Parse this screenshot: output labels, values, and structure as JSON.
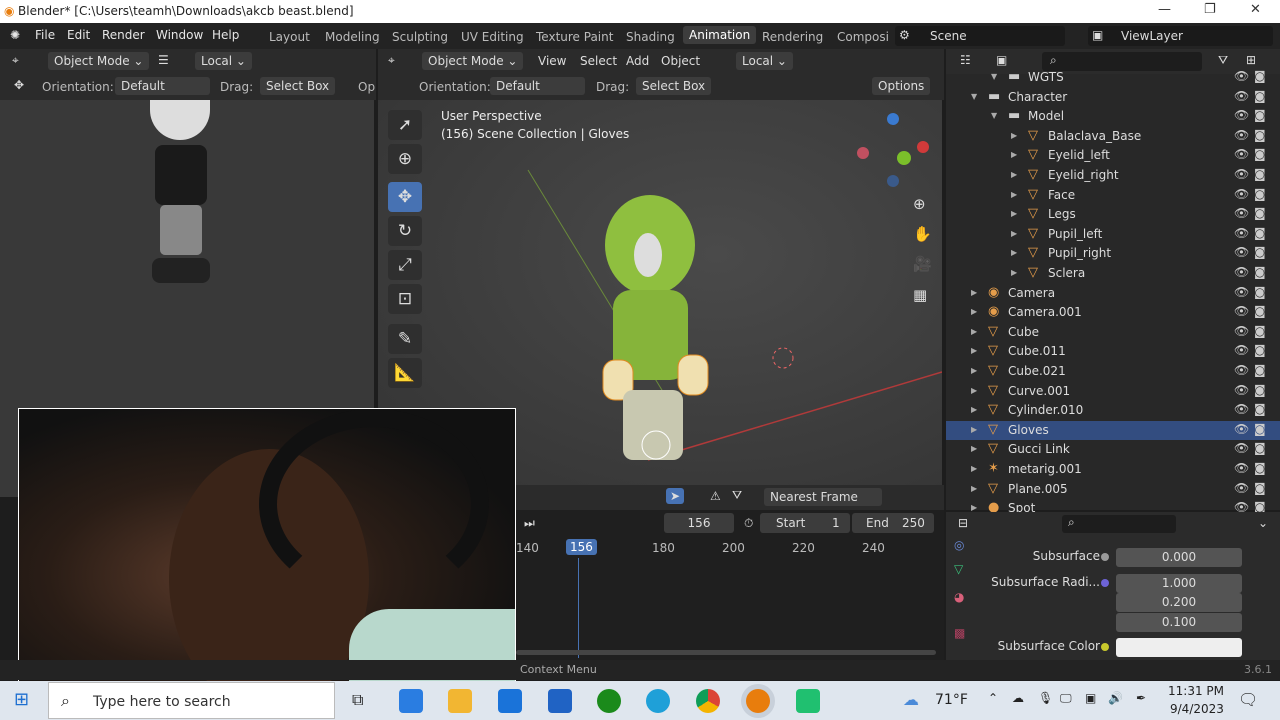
{
  "window": {
    "title": "Blender* [C:\\Users\\teamh\\Downloads\\akcb beast.blend]"
  },
  "menu": [
    "File",
    "Edit",
    "Render",
    "Window",
    "Help"
  ],
  "workspaces": [
    "Layout",
    "Modeling",
    "Sculpting",
    "UV Editing",
    "Texture Paint",
    "Shading",
    "Animation",
    "Rendering",
    "Composi"
  ],
  "active_workspace": "Animation",
  "scene": "Scene",
  "view_layer": "ViewLayer",
  "left_view": {
    "mode": "Object Mode",
    "transform": "Local",
    "orientation_label": "Orientation:",
    "orientation": "Default",
    "drag_label": "Drag:",
    "drag": "Select Box",
    "options": "Op"
  },
  "main_view": {
    "mode": "Object Mode",
    "menus": [
      "View",
      "Select",
      "Add",
      "Object"
    ],
    "transform": "Local",
    "orientation_label": "Orientation:",
    "orientation": "Default",
    "drag_label": "Drag:",
    "drag": "Select Box",
    "options": "Options",
    "perspective": "User Perspective",
    "collection": "(156) Scene Collection | Gloves"
  },
  "outliner": {
    "items": [
      {
        "name": "WGTS",
        "type": "collection",
        "depth": 2
      },
      {
        "name": "Character",
        "type": "collection",
        "depth": 1
      },
      {
        "name": "Model",
        "type": "collection",
        "depth": 2
      },
      {
        "name": "Balaclava_Base",
        "type": "mesh",
        "depth": 3
      },
      {
        "name": "Eyelid_left",
        "type": "mesh",
        "depth": 3
      },
      {
        "name": "Eyelid_right",
        "type": "mesh",
        "depth": 3
      },
      {
        "name": "Face",
        "type": "mesh",
        "depth": 3
      },
      {
        "name": "Legs",
        "type": "mesh",
        "depth": 3
      },
      {
        "name": "Pupil_left",
        "type": "mesh",
        "depth": 3
      },
      {
        "name": "Pupil_right",
        "type": "mesh",
        "depth": 3
      },
      {
        "name": "Sclera",
        "type": "mesh",
        "depth": 3
      },
      {
        "name": "Camera",
        "type": "camera",
        "depth": 1
      },
      {
        "name": "Camera.001",
        "type": "camera",
        "depth": 1
      },
      {
        "name": "Cube",
        "type": "mesh",
        "depth": 1
      },
      {
        "name": "Cube.011",
        "type": "mesh",
        "depth": 1
      },
      {
        "name": "Cube.021",
        "type": "mesh",
        "depth": 1
      },
      {
        "name": "Curve.001",
        "type": "mesh",
        "depth": 1
      },
      {
        "name": "Cylinder.010",
        "type": "mesh",
        "depth": 1
      },
      {
        "name": "Gloves",
        "type": "mesh",
        "depth": 1,
        "selected": true
      },
      {
        "name": "Gucci Link",
        "type": "mesh",
        "depth": 1
      },
      {
        "name": "metarig.001",
        "type": "armature",
        "depth": 1
      },
      {
        "name": "Plane.005",
        "type": "mesh",
        "depth": 1
      },
      {
        "name": "Spot",
        "type": "light",
        "depth": 1
      }
    ]
  },
  "timeline": {
    "keying": "Nearest Frame",
    "current_frame": "156",
    "start_label": "Start",
    "start": "1",
    "end_label": "End",
    "end": "250",
    "ticks": [
      "140",
      "180",
      "200",
      "220",
      "240"
    ],
    "playhead": "156"
  },
  "properties": {
    "rows": [
      {
        "label": "Subsurface",
        "values": [
          "0.000"
        ],
        "dot": "#9a9a9a"
      },
      {
        "label": "Subsurface Radi...",
        "values": [
          "1.000",
          "0.200",
          "0.100"
        ],
        "dot": "#6d63d6"
      },
      {
        "label": "Subsurface Color",
        "values": [
          ""
        ],
        "dot": "#c8c82c"
      }
    ]
  },
  "status": {
    "context": "Context Menu",
    "version": "3.6.1"
  },
  "taskbar": {
    "search_placeholder": "Type here to search",
    "weather": "71°F",
    "time": "11:31 PM",
    "date": "9/4/2023"
  }
}
